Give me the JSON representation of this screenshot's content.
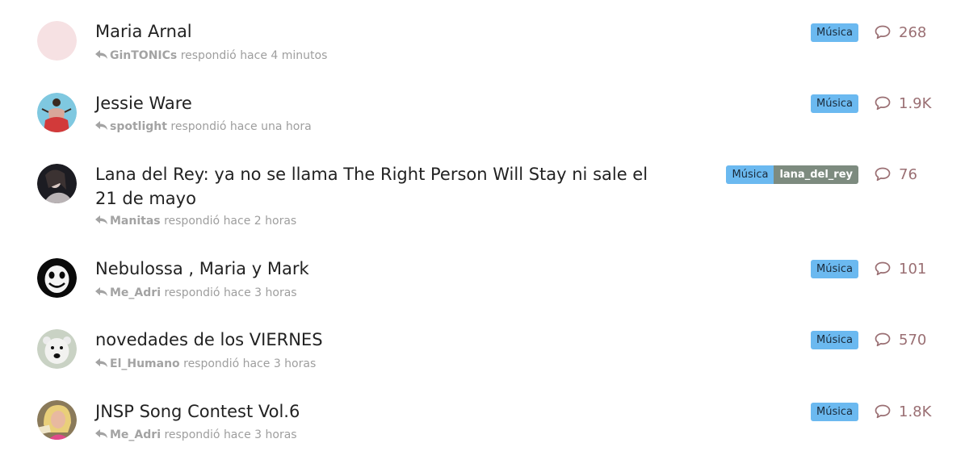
{
  "category_color": "#6bb9f0",
  "extra_tag_color": "#7d8b7f",
  "topics": [
    {
      "title": "Maria Arnal",
      "last_poster": "GinTONICs",
      "action": "respondió",
      "time": "hace 4 minutos",
      "category": "Música",
      "replies": "268",
      "avatar": "blank-pink-avatar"
    },
    {
      "title": "Jessie Ware",
      "last_poster": "spotlight",
      "action": "respondió",
      "time": "hace una hora",
      "category": "Música",
      "replies": "1.9K",
      "avatar": "figure-on-blue-avatar"
    },
    {
      "title": "Lana del Rey: ya no se llama The Right Person Will Stay ni sale el 21 de mayo",
      "last_poster": "Manitas",
      "action": "respondió",
      "time": "hace 2 horas",
      "category": "Música",
      "extra_tag": "lana_del_rey",
      "replies": "76",
      "avatar": "dark-portrait-avatar"
    },
    {
      "title": "Nebulossa , Maria y Mark",
      "last_poster": "Me_Adri",
      "action": "respondió",
      "time": "hace 3 horas",
      "category": "Música",
      "replies": "101",
      "avatar": "white-mask-avatar"
    },
    {
      "title": "novedades de los VIERNES",
      "last_poster": "El_Humano",
      "action": "respondió",
      "time": "hace 3 horas",
      "category": "Música",
      "replies": "570",
      "avatar": "polar-bear-avatar"
    },
    {
      "title": "JNSP Song Contest Vol.6",
      "last_poster": "Me_Adri",
      "action": "respondió",
      "time": "hace 3 horas",
      "category": "Música",
      "replies": "1.8K",
      "avatar": "blonde-woman-avatar"
    }
  ]
}
